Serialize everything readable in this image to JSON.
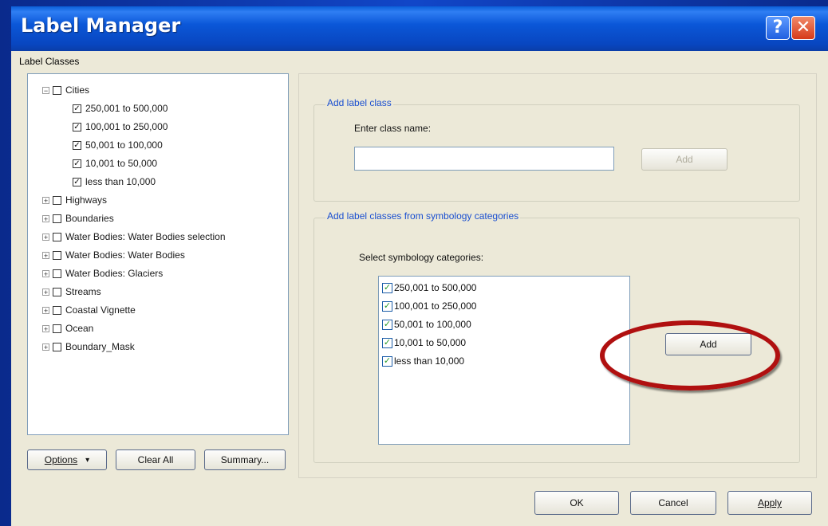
{
  "window": {
    "title": "Label Manager",
    "help_icon": "?",
    "close_icon": "✕"
  },
  "label_classes": {
    "caption": "Label Classes",
    "tree": [
      {
        "label": "Cities",
        "expanded": true,
        "checked": false,
        "level": 0
      },
      {
        "label": "250,001 to 500,000",
        "checked": true,
        "level": 1
      },
      {
        "label": "100,001 to 250,000",
        "checked": true,
        "level": 1
      },
      {
        "label": "50,001 to 100,000",
        "checked": true,
        "level": 1
      },
      {
        "label": "10,001 to 50,000",
        "checked": true,
        "level": 1
      },
      {
        "label": "less than 10,000",
        "checked": true,
        "level": 1
      },
      {
        "label": "Highways",
        "expanded": false,
        "checked": false,
        "level": 0
      },
      {
        "label": "Boundaries",
        "expanded": false,
        "checked": false,
        "level": 0
      },
      {
        "label": "Water Bodies: Water Bodies selection",
        "expanded": false,
        "checked": false,
        "level": 0
      },
      {
        "label": "Water Bodies: Water Bodies",
        "expanded": false,
        "checked": false,
        "level": 0
      },
      {
        "label": "Water Bodies: Glaciers",
        "expanded": false,
        "checked": false,
        "level": 0
      },
      {
        "label": "Streams",
        "expanded": false,
        "checked": false,
        "level": 0
      },
      {
        "label": "Coastal Vignette",
        "expanded": false,
        "checked": false,
        "level": 0
      },
      {
        "label": "Ocean",
        "expanded": false,
        "checked": false,
        "level": 0
      },
      {
        "label": "Boundary_Mask",
        "expanded": false,
        "checked": false,
        "level": 0
      }
    ],
    "options_label": "Options",
    "options_arrow": "▾",
    "clear_all_label": "Clear All",
    "summary_label": "Summary..."
  },
  "add_label_class": {
    "legend": "Add label class",
    "enter_name_label": "Enter class name:",
    "class_name_value": "",
    "add_label": "Add"
  },
  "from_symbology": {
    "legend": "Add label classes from symbology categories",
    "select_label": "Select symbology categories:",
    "items": [
      {
        "label": "250,001 to 500,000",
        "checked": true
      },
      {
        "label": "100,001 to 250,000",
        "checked": true
      },
      {
        "label": "50,001 to 100,000",
        "checked": true
      },
      {
        "label": "10,001 to 50,000",
        "checked": true
      },
      {
        "label": "less than 10,000",
        "checked": true
      }
    ],
    "add_label": "Add"
  },
  "footer": {
    "ok_label": "OK",
    "cancel_label": "Cancel",
    "apply_label": "Apply"
  },
  "colors": {
    "titlebar": "#0b57d8",
    "dialog_bg": "#ece9d8",
    "legend_text": "#1a4fd0",
    "highlight_ring": "#b01010"
  }
}
